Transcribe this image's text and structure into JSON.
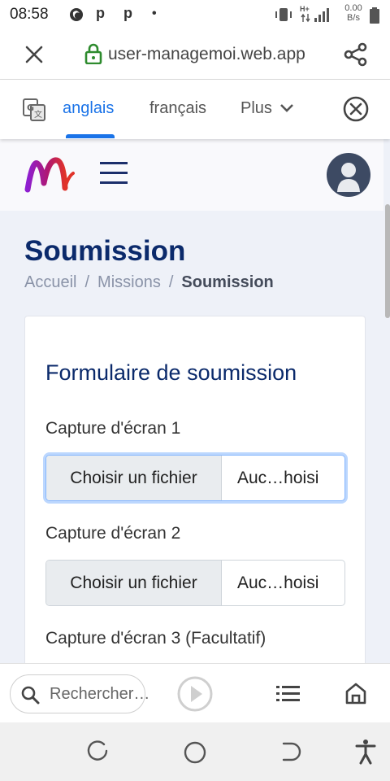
{
  "status_bar": {
    "time": "08:58",
    "notification_icons": [
      "p",
      "p"
    ],
    "more_dot": "•",
    "network_type": "H+",
    "speed_value": "0.00",
    "speed_unit": "B/s"
  },
  "url_bar": {
    "url": "user-managemoi.web.app"
  },
  "translate_bar": {
    "tabs": [
      {
        "label": "anglais",
        "active": true
      },
      {
        "label": "français",
        "active": false
      }
    ],
    "more_label": "Plus"
  },
  "page": {
    "title": "Soumission",
    "breadcrumb": {
      "items": [
        "Accueil",
        "Missions"
      ],
      "separator": "/",
      "current": "Soumission"
    },
    "form": {
      "title": "Formulaire de soumission",
      "fields": [
        {
          "label": "Capture d'écran 1",
          "button": "Choisir un fichier",
          "file": "Auc…hoisi"
        },
        {
          "label": "Capture d'écran 2",
          "button": "Choisir un fichier",
          "file": "Auc…hoisi"
        },
        {
          "label": "Capture d'écran 3 (Facultatif)"
        }
      ]
    }
  },
  "bottom_bar": {
    "search_placeholder": "Rechercher…"
  },
  "colors": {
    "accent": "#1a73e8",
    "title": "#0b2a6b",
    "page_bg": "#eef1f8"
  }
}
